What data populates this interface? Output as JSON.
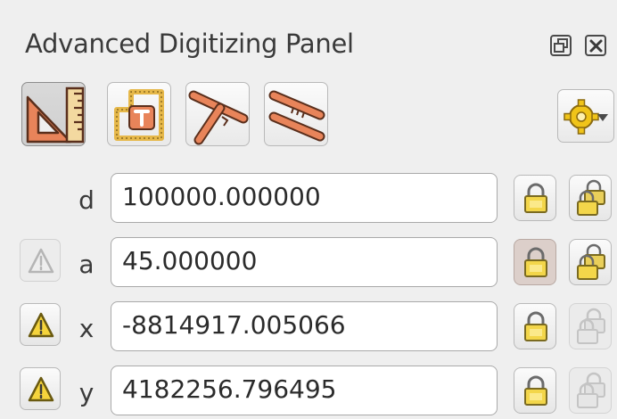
{
  "panel": {
    "title": "Advanced Digitizing Panel",
    "float_icon": "float-window-icon",
    "close_icon": "close-icon"
  },
  "toolbar": {
    "tools": [
      {
        "icon": "construction-ruler-icon",
        "active": true
      },
      {
        "icon": "topology-snapping-icon",
        "active": false
      },
      {
        "icon": "perpendicular-icon",
        "active": false
      },
      {
        "icon": "parallel-icon",
        "active": false
      }
    ],
    "settings_icon": "gear-dropdown-icon"
  },
  "fields": {
    "d": {
      "label": "d",
      "value": "100000.000000"
    },
    "a": {
      "label": "a",
      "value": "45.000000"
    },
    "x": {
      "label": "x",
      "value": "-8814917.005066"
    },
    "y": {
      "label": "y",
      "value": "4182256.796495"
    }
  },
  "colors": {
    "accent_orange": "#e8845a",
    "lock_yellow": "#f3d64a",
    "warning_yellow": "#f5d43c",
    "panel_bg": "#efefef"
  }
}
